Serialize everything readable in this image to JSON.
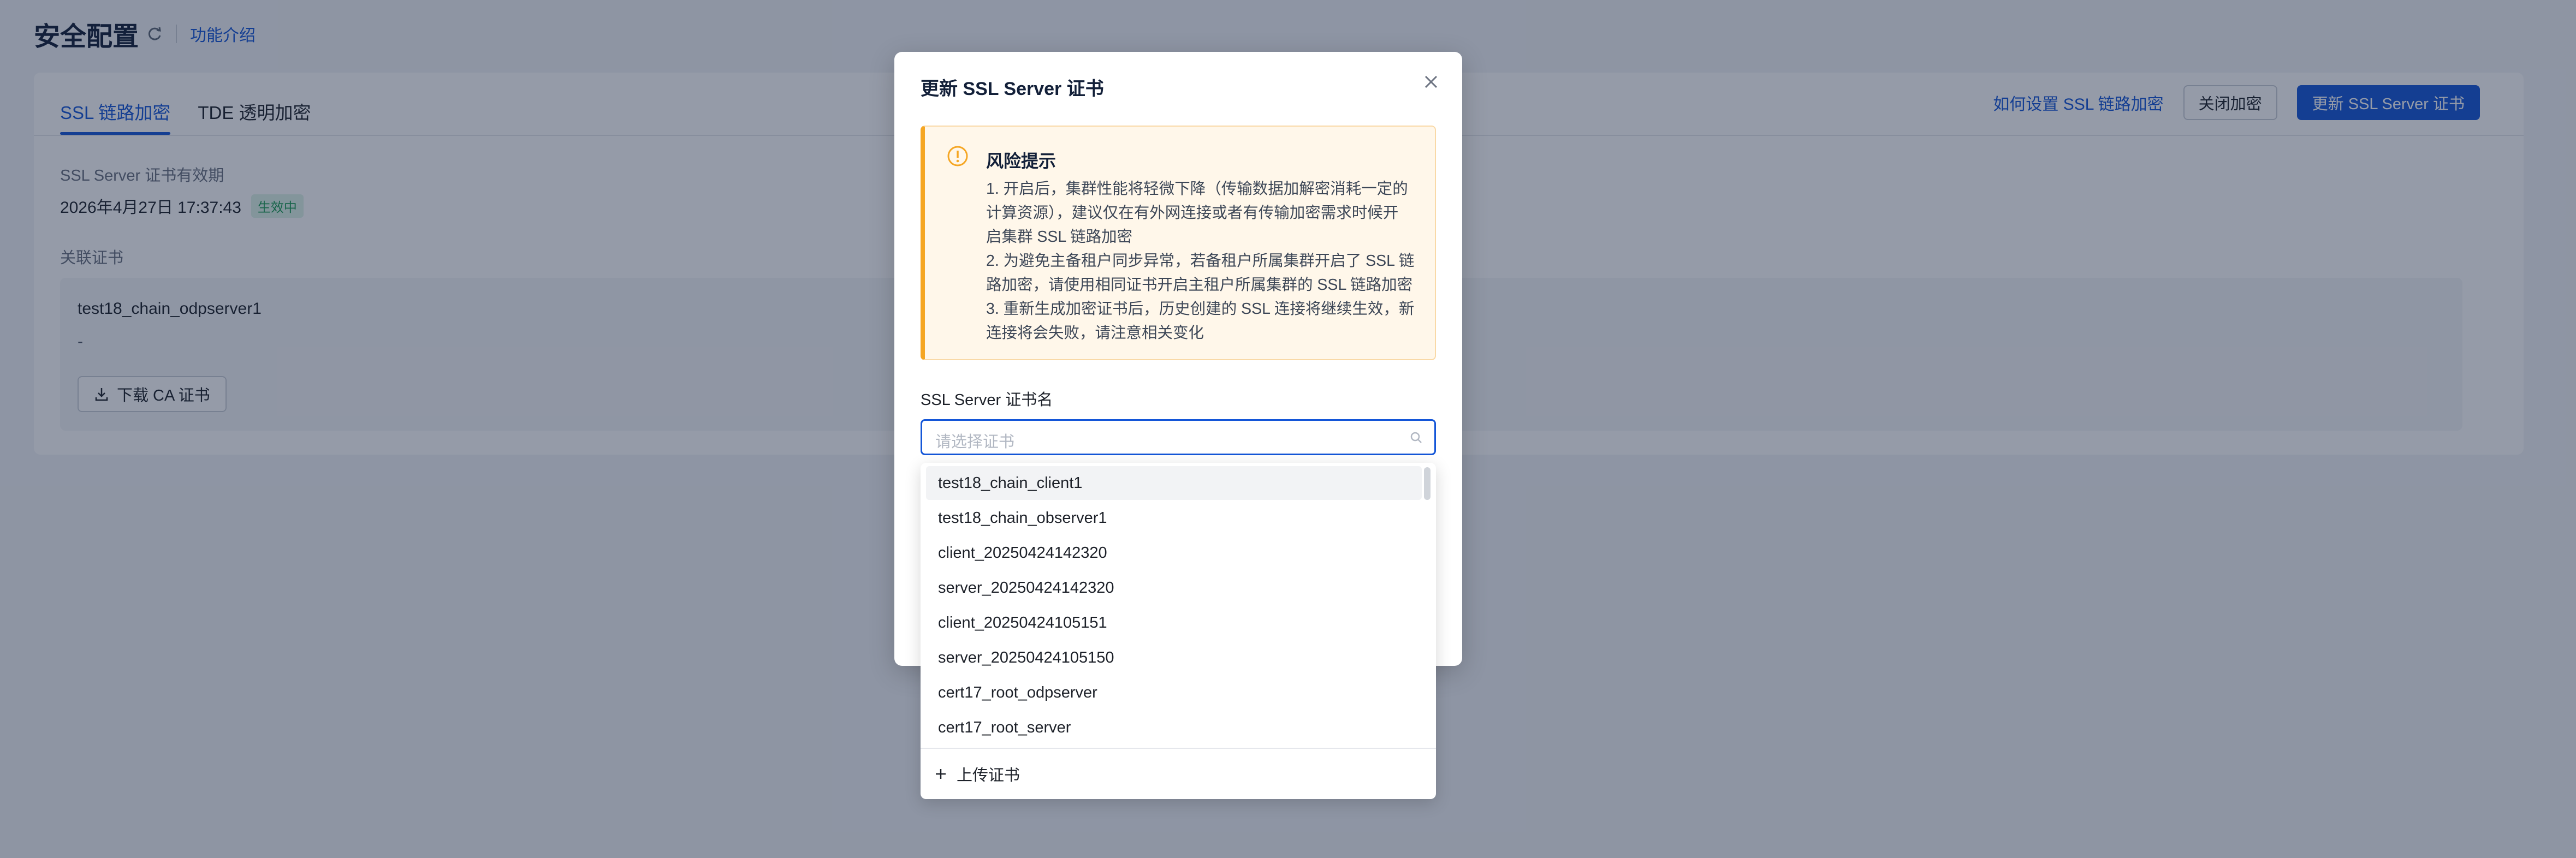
{
  "page": {
    "title": "安全配置",
    "intro_link": "功能介绍"
  },
  "tabs": [
    {
      "label": "SSL 链路加密",
      "active": true
    },
    {
      "label": "TDE 透明加密",
      "active": false
    }
  ],
  "actions": {
    "help_link": "如何设置 SSL 链路加密",
    "close_button": "关闭加密",
    "update_button": "更新 SSL Server 证书"
  },
  "cert_validity": {
    "label": "SSL Server 证书有效期",
    "value": "2026年4月27日 17:37:43",
    "status": "生效中"
  },
  "related": {
    "label": "关联证书",
    "cert_name": "test18_chain_odpserver1",
    "dash": "-",
    "download_button": "下载 CA 证书"
  },
  "modal": {
    "title": "更新 SSL Server 证书",
    "alert": {
      "title": "风险提示",
      "lines": [
        "1. 开启后，集群性能将轻微下降（传输数据加解密消耗一定的",
        "计算资源），建议仅在有外网连接或者有传输加密需求时候开",
        "启集群 SSL 链路加密",
        "2. 为避免主备租户同步异常，若备租户所属集群开启了 SSL 链",
        "路加密，请使用相同证书开启主租户所属集群的 SSL 链路加密",
        "3. 重新生成加密证书后，历史创建的 SSL 连接将继续生效，新",
        "连接将会失败，请注意相关变化"
      ]
    },
    "field_label": "SSL Server 证书名",
    "select_placeholder": "请选择证书"
  },
  "dropdown": {
    "options": [
      "test18_chain_client1",
      "test18_chain_observer1",
      "client_20250424142320",
      "server_20250424142320",
      "client_20250424105151",
      "server_20250424105150",
      "cert17_root_odpserver",
      "cert17_root_server"
    ],
    "upload_label": "上传证书"
  },
  "colors": {
    "accent": "#1456d8",
    "warning": "#f5a623",
    "success": "#1e9d56"
  }
}
